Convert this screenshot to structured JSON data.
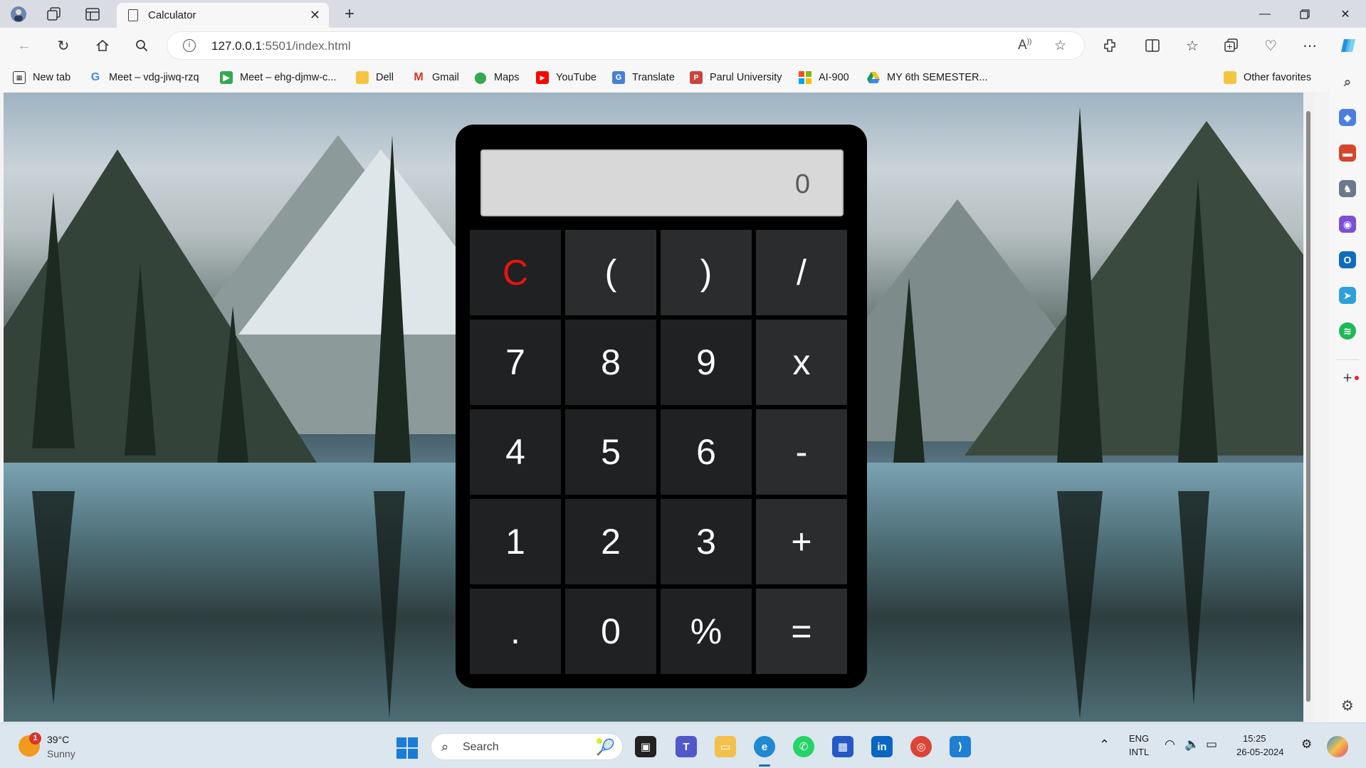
{
  "browser": {
    "tab_title": "Calculator",
    "url_host": "127.0.0.1",
    "url_path": ":5501/index.html"
  },
  "favorites": [
    {
      "label": "New tab",
      "icon": "new-tab-icon"
    },
    {
      "label": "Meet – vdg-jiwq-rzq",
      "icon": "google-icon"
    },
    {
      "label": "Meet – ehg-djmw-c...",
      "icon": "meet-icon"
    },
    {
      "label": "Dell",
      "icon": "folder-icon"
    },
    {
      "label": "Gmail",
      "icon": "gmail-icon"
    },
    {
      "label": "Maps",
      "icon": "maps-icon"
    },
    {
      "label": "YouTube",
      "icon": "youtube-icon"
    },
    {
      "label": "Translate",
      "icon": "translate-icon"
    },
    {
      "label": "Parul University",
      "icon": "parul-icon"
    },
    {
      "label": "AI-900",
      "icon": "microsoft-icon"
    },
    {
      "label": "MY 6th SEMESTER...",
      "icon": "drive-icon"
    }
  ],
  "other_favorites": "Other favorites",
  "calculator": {
    "display": "0",
    "keys": [
      {
        "label": "C",
        "name": "clear"
      },
      {
        "label": "(",
        "name": "open-paren"
      },
      {
        "label": ")",
        "name": "close-paren"
      },
      {
        "label": "/",
        "name": "divide"
      },
      {
        "label": "7",
        "name": "seven"
      },
      {
        "label": "8",
        "name": "eight"
      },
      {
        "label": "9",
        "name": "nine"
      },
      {
        "label": "x",
        "name": "multiply"
      },
      {
        "label": "4",
        "name": "four"
      },
      {
        "label": "5",
        "name": "five"
      },
      {
        "label": "6",
        "name": "six"
      },
      {
        "label": "-",
        "name": "subtract"
      },
      {
        "label": "1",
        "name": "one"
      },
      {
        "label": "2",
        "name": "two"
      },
      {
        "label": "3",
        "name": "three"
      },
      {
        "label": "+",
        "name": "add"
      },
      {
        "label": ".",
        "name": "decimal"
      },
      {
        "label": "0",
        "name": "zero"
      },
      {
        "label": "%",
        "name": "percent"
      },
      {
        "label": "=",
        "name": "equals"
      }
    ]
  },
  "taskbar": {
    "weather_temp": "39°C",
    "weather_desc": "Sunny",
    "weather_badge": "1",
    "search_label": "Search",
    "lang_top": "ENG",
    "lang_bottom": "INTL",
    "time": "15:25",
    "date": "26-05-2024"
  },
  "colors": {
    "clear_key": "#e8140e",
    "display_bg": "#d8d8d8",
    "key_bg": "#1f2123",
    "calculator_bg": "#000000"
  }
}
